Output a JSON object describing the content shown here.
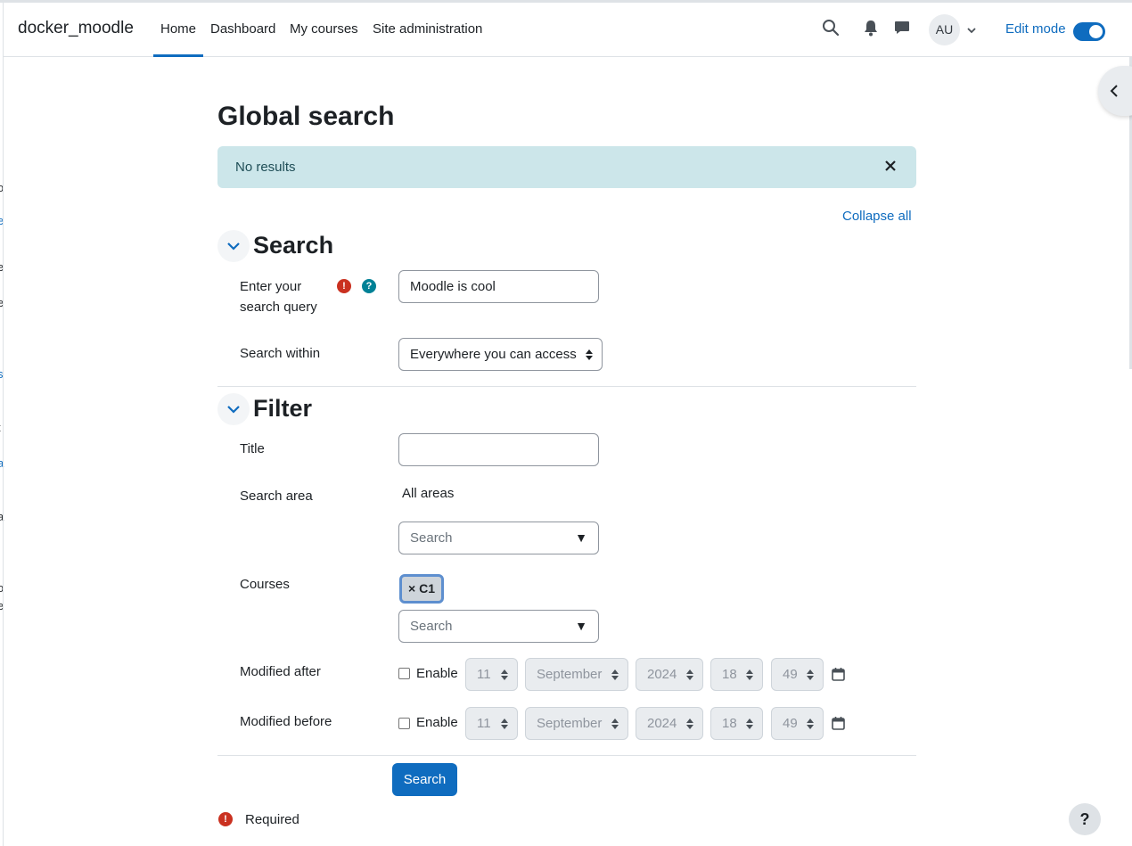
{
  "navbar": {
    "brand": "docker_moodle",
    "items": [
      {
        "label": "Home",
        "active": true
      },
      {
        "label": "Dashboard"
      },
      {
        "label": "My courses"
      },
      {
        "label": "Site administration"
      }
    ],
    "user_initials": "AU",
    "edit_mode_label": "Edit mode",
    "edit_mode_on": true
  },
  "page": {
    "title": "Global search",
    "alert_text": "No results",
    "collapse_all": "Collapse all"
  },
  "search_section": {
    "title": "Search",
    "query_label": "Enter your search query",
    "query_value": "Moodle is cool",
    "within_label": "Search within",
    "within_value": "Everywhere you can access"
  },
  "filter_section": {
    "title": "Filter",
    "title_label": "Title",
    "title_value": "",
    "area_label": "Search area",
    "area_value": "All areas",
    "area_placeholder": "Search",
    "courses_label": "Courses",
    "course_badge": "× C1",
    "courses_placeholder": "Search",
    "modified_after": {
      "label": "Modified after",
      "enable": "Enable",
      "day": "11",
      "month": "September",
      "year": "2024",
      "hour": "18",
      "minute": "49"
    },
    "modified_before": {
      "label": "Modified before",
      "enable": "Enable",
      "day": "11",
      "month": "September",
      "year": "2024",
      "hour": "18",
      "minute": "49"
    }
  },
  "actions": {
    "search_button": "Search",
    "required_text": "Required"
  },
  "help_fab": "?",
  "colors": {
    "primary": "#0f6cbf",
    "alert_bg": "#cce6ea",
    "required": "#ca3120",
    "help": "#008196"
  }
}
